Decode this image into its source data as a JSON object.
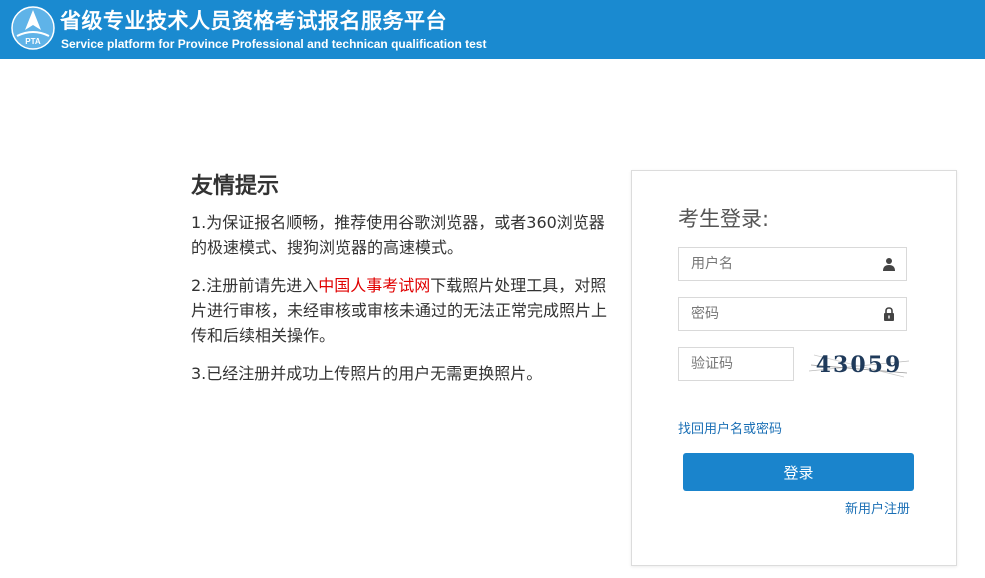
{
  "header": {
    "logo_text": "PTA",
    "title_cn": "省级专业技术人员资格考试报名服务平台",
    "title_en": "Service platform for Province Professional and technican qualification test",
    "background": "#1a8ad0"
  },
  "tips": {
    "heading": "友情提示",
    "item1": "1.为保证报名顺畅，推荐使用谷歌浏览器，或者360浏览器的极速模式、搜狗浏览器的高速模式。",
    "item2_before": "2.注册前请先进入",
    "item2_link": "中国人事考试网",
    "item2_after": "下载照片处理工具，对照片进行审核，未经审核或审核未通过的无法正常完成照片上传和后续相关操作。",
    "item3": "3.已经注册并成功上传照片的用户无需更换照片。",
    "link_color": "#e00000"
  },
  "login": {
    "title": "考生登录:",
    "username_placeholder": "用户名",
    "username_icon": "user-icon",
    "password_placeholder": "密码",
    "password_icon": "lock-icon",
    "captcha_placeholder": "验证码",
    "captcha_text": "43059",
    "forgot_link": "找回用户名或密码",
    "submit_label": "登录",
    "register_link": "新用户注册",
    "button_color": "#1a84cc"
  }
}
